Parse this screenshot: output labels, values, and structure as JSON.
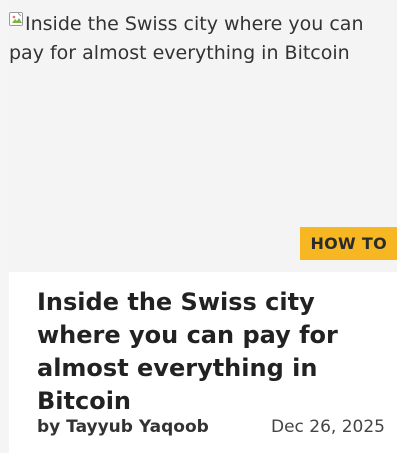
{
  "article": {
    "image_alt": "Inside the Swiss city where you can pay for almost everything in Bitcoin",
    "category_badge": "HOW TO",
    "title": "Inside the Swiss city where you can pay for almost everything in Bitcoin",
    "author": "by Tayyub Yaqoob",
    "date": "Dec 26, 2025"
  },
  "colors": {
    "badge_bg": "#f6b722",
    "image_placeholder_bg": "#f4f4f4",
    "title_text": "#222222"
  },
  "icons": {
    "broken_image": "broken-image-icon"
  }
}
